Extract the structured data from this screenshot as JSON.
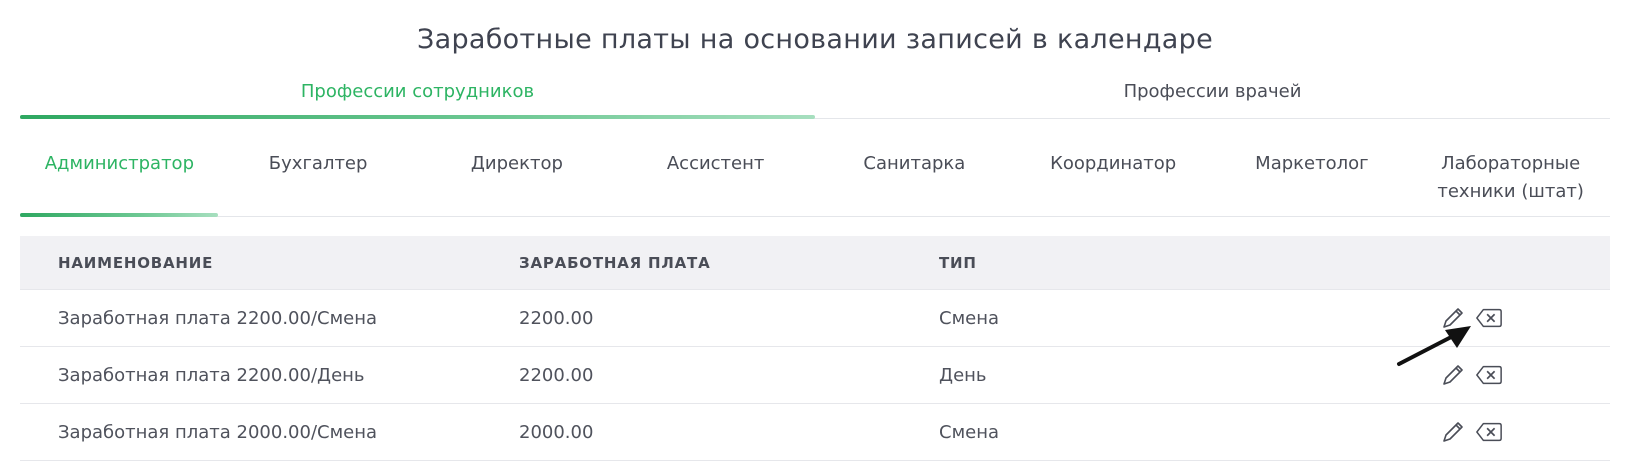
{
  "page": {
    "title": "Заработные платы на основании записей в календаре"
  },
  "top_tabs": [
    {
      "label": "Профессии сотрудников",
      "active": true
    },
    {
      "label": "Профессии врачей",
      "active": false
    }
  ],
  "profession_tabs": [
    {
      "label": "Администратор",
      "active": true
    },
    {
      "label": "Бухгалтер",
      "active": false
    },
    {
      "label": "Директор",
      "active": false
    },
    {
      "label": "Ассистент",
      "active": false
    },
    {
      "label": "Санитарка",
      "active": false
    },
    {
      "label": "Координатор",
      "active": false
    },
    {
      "label": "Маркетолог",
      "active": false
    },
    {
      "label": "Лабораторные техники (штат)",
      "active": false
    }
  ],
  "table": {
    "headers": {
      "name": "НАИМЕНОВАНИЕ",
      "pay": "ЗАРАБОТНАЯ ПЛАТА",
      "type": "ТИП"
    },
    "rows": [
      {
        "name": "Заработная плата 2200.00/Смена",
        "pay": "2200.00",
        "type": "Смена"
      },
      {
        "name": "Заработная плата 2200.00/День",
        "pay": "2200.00",
        "type": "День"
      },
      {
        "name": "Заработная плата 2000.00/Смена",
        "pay": "2000.00",
        "type": "Смена"
      }
    ],
    "row_actions": [
      "pencil-icon",
      "backspace-icon"
    ]
  },
  "colors": {
    "accent_green": "#2db463",
    "header_bg": "#f1f1f4",
    "text": "#4a4d57"
  }
}
